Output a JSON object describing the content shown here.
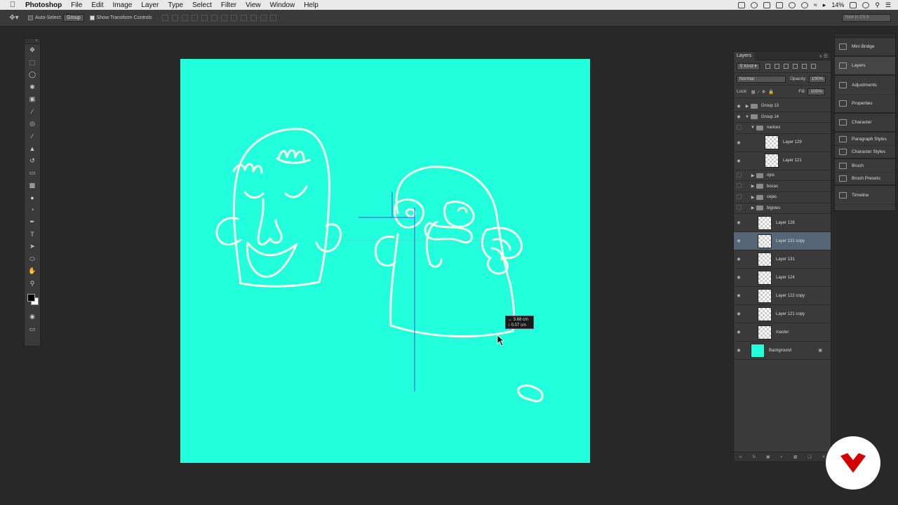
{
  "menubar": {
    "app": "Photoshop",
    "menus": [
      "File",
      "Edit",
      "Image",
      "Layer",
      "Type",
      "Select",
      "Filter",
      "View",
      "Window",
      "Help"
    ],
    "battery": "14%"
  },
  "options": {
    "auto_select_label": "Auto-Select:",
    "auto_select_value": "Group",
    "transform_label": "Show Transform Controls",
    "workspace": "New in CS 6"
  },
  "measure": {
    "w": "3.68 cm",
    "h": "0.07 cm"
  },
  "layers": {
    "tab": "Layers",
    "filter_kind": "Kind",
    "blend_mode": "Normal",
    "opacity_label": "Opacity:",
    "opacity": "100%",
    "lock_label": "Lock:",
    "fill_label": "Fill:",
    "fill": "100%",
    "items": [
      {
        "name": "Group 13"
      },
      {
        "name": "Group 14"
      },
      {
        "name": "narices"
      },
      {
        "name": "Layer 129"
      },
      {
        "name": "Layer 121"
      },
      {
        "name": "ojos"
      },
      {
        "name": "bocas"
      },
      {
        "name": "cejas"
      },
      {
        "name": "bigotes"
      },
      {
        "name": "Layer 128"
      },
      {
        "name": "Layer 131 copy"
      },
      {
        "name": "Layer 131"
      },
      {
        "name": "Layer 124"
      },
      {
        "name": "Layer 122 copy"
      },
      {
        "name": "Layer 121 copy"
      },
      {
        "name": "master"
      },
      {
        "name": "Background"
      }
    ]
  },
  "dock": {
    "items": [
      "Mini Bridge",
      "Layers",
      "Adjustments",
      "Properties",
      "Character",
      "Paragraph Styles",
      "Character Styles",
      "Brush",
      "Brush Presets",
      "Timeline"
    ]
  },
  "colors": {
    "canvas": "#22ffdd",
    "selected_layer": "#566677",
    "logo": "#d40000"
  }
}
